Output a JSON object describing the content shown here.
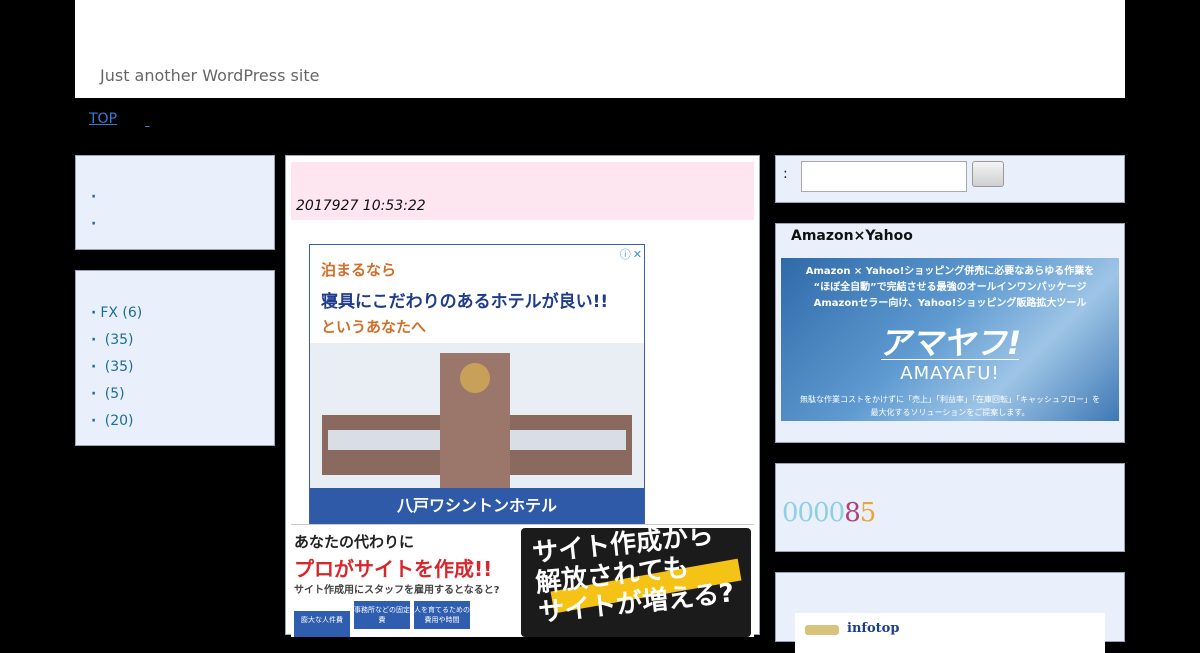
{
  "header": {
    "tagline": "Just another WordPress site"
  },
  "nav": {
    "top_label": "TOP"
  },
  "left_sidebar": {
    "box1_items": [
      "",
      ""
    ],
    "categories": [
      {
        "label": "FX (6)"
      },
      {
        "label": " (35)"
      },
      {
        "label": " (35)"
      },
      {
        "label": " (5)"
      },
      {
        "label": " (20)"
      }
    ]
  },
  "post": {
    "timestamp": "2017927 10:53:22"
  },
  "ad1": {
    "line1": "泊まるなら",
    "line2": "寝具にこだわりのあるホテルが良い!!",
    "line3": "というあなたへ",
    "footer": "八戸ワシントンホテル",
    "choice_icon": "info-icon",
    "close_icon": "close-icon"
  },
  "ad2": {
    "line1": "あなたの代わりに",
    "line2": "プロがサイトを作成!!",
    "line3": "サイト作成用にスタッフを雇用するとなると?",
    "chips": [
      "膨大な人件費",
      "事務所などの固定費",
      "人を育てるための費用や時間"
    ],
    "headline": "サイト作成から\n解放されても\nサイトが増える?"
  },
  "search": {
    "colon": ":",
    "placeholder": "",
    "value": ""
  },
  "amazon_widget": {
    "title": "Amazon×Yahoo",
    "banner_line1": "Amazon × Yahoo!ショッピング併売に必要なあらゆる作業を",
    "banner_line2": "“ほぼ全自動”で完結させる最強のオールインワンパッケージ",
    "banner_line3": "Amazonセラー向け、Yahoo!ショッピング販路拡大ツール",
    "banner_logo": "アマヤフ!",
    "banner_sub": "AMAYAFU!",
    "banner_foot1": "無駄な作業コストをかけずに「売上」「利益率」「在庫回転」「キャッシュフロー」を",
    "banner_foot2": "最大化するソリューションをご提案します。"
  },
  "counter": {
    "digits": [
      "0",
      "0",
      "0",
      "0",
      "8",
      "5"
    ],
    "colors": [
      "#8fd0e0",
      "#8fd0e0",
      "#8fd0e0",
      "#8fd0e0",
      "#b0407a",
      "#e8a63a"
    ]
  },
  "last_widget": {
    "text": "infotop"
  },
  "colors": {
    "panel_bg": "#eaf0fb",
    "pink_bar": "#fde6f0",
    "link": "#1c6d9c",
    "page_bg": "#000000"
  }
}
